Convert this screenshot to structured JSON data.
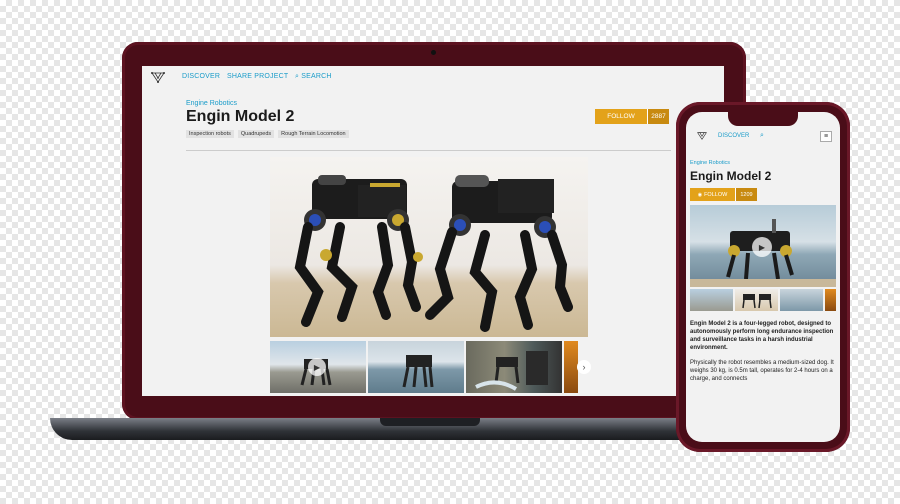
{
  "desktop": {
    "nav": {
      "discover": "DISCOVER",
      "share_project": "SHARE PROJECT",
      "search": "SEARCH"
    },
    "company": "Engine Robotics",
    "title": "Engin Model 2",
    "tags": [
      "Inspection robots",
      "Quadrupeds",
      "Rough Terrain Locomotion"
    ],
    "follow": {
      "label": "FOLLOW",
      "count": "2887"
    },
    "next_arrow": "›"
  },
  "mobile": {
    "nav": {
      "discover": "DISCOVER",
      "search_icon": "search-icon",
      "menu_icon": "hamburger-icon"
    },
    "company": "Engine Robotics",
    "title": "Engin Model 2",
    "follow": {
      "label": "FOLLOW",
      "count": "1209"
    },
    "description_lead": "Engin Model 2 is a four-legged robot, designed to autonomously perform long endurance inspection and surveillance tasks in a harsh industrial environment.",
    "description_body": "Physically the robot resembles a medium-sized dog. It weighs 30 kg, is 0.5m tall, operates for 2-4 hours on a charge, and connects"
  },
  "colors": {
    "accent": "#1a9cc9",
    "follow": "#e3a21a",
    "device_frame": "#4a0d18"
  }
}
